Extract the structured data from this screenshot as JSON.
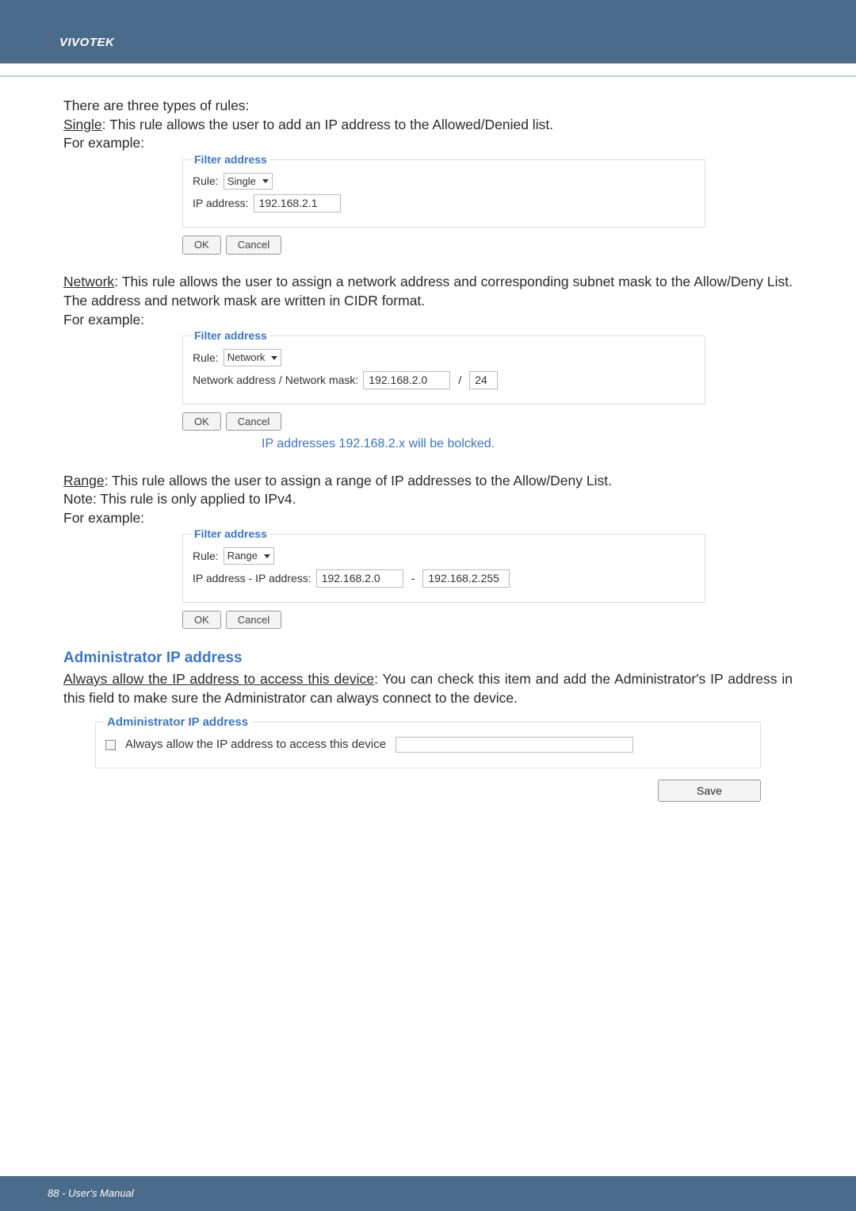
{
  "header": {
    "brand": "VIVOTEK"
  },
  "intro": {
    "types_line": "There are three types of rules:",
    "single_label": "Single",
    "single_desc": ": This rule allows the user to add an IP address to the Allowed/Denied list.",
    "for_example": "For example:"
  },
  "fs_single": {
    "title": "Filter address",
    "rule_label": "Rule:",
    "rule_value": "Single",
    "ip_label": "IP address:",
    "ip_value": "192.168.2.1",
    "ok": "OK",
    "cancel": "Cancel"
  },
  "network_para": {
    "label": "Network",
    "desc": ": This rule allows the user to assign a network address and corresponding subnet mask to the Allow/Deny List. The address and network mask are written in CIDR format.",
    "for_example": "For example:"
  },
  "fs_network": {
    "title": "Filter address",
    "rule_label": "Rule:",
    "rule_value": "Network",
    "addr_label": "Network address / Network mask:",
    "addr_value": "192.168.2.0",
    "slash": "/",
    "mask_value": "24",
    "ok": "OK",
    "cancel": "Cancel",
    "callout": "IP addresses 192.168.2.x will be bolcked."
  },
  "range_para": {
    "label": "Range",
    "desc": ": This rule allows the user to assign a range of IP addresses to the Allow/Deny List.",
    "note": "Note: This rule is only applied to IPv4.",
    "for_example": "For example:"
  },
  "fs_range": {
    "title": "Filter address",
    "rule_label": "Rule:",
    "rule_value": "Range",
    "addr_label": "IP address - IP address:",
    "from_value": "192.168.2.0",
    "dash": "-",
    "to_value": "192.168.2.255",
    "ok": "OK",
    "cancel": "Cancel"
  },
  "admin": {
    "title": "Administrator IP address",
    "always_label": "Always allow the IP address to access this device",
    "para": ": You can check this item and add the Administrator's IP address in this field to make sure the Administrator can always connect to the device.",
    "box_title": "Administrator IP address",
    "checkbox_label": "Always allow the IP address to access this device",
    "save": "Save"
  },
  "footer": {
    "text": "88 - User's Manual"
  }
}
